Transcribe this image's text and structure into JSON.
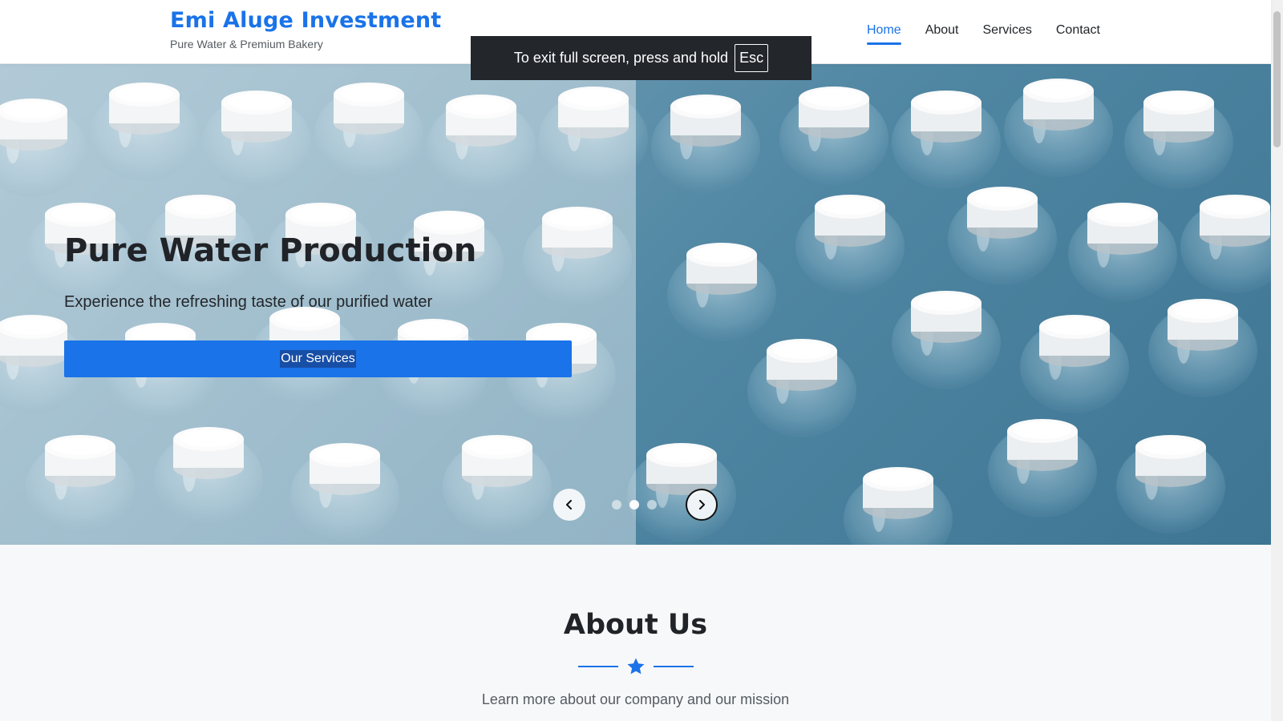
{
  "header": {
    "brand_title": "Emi Aluge Investment",
    "brand_subtitle": "Pure Water & Premium Bakery",
    "nav": [
      {
        "label": "Home",
        "active": true
      },
      {
        "label": "About",
        "active": false
      },
      {
        "label": "Services",
        "active": false
      },
      {
        "label": "Contact",
        "active": false
      }
    ]
  },
  "fullscreen_notice": {
    "text": "To exit full screen, press and hold",
    "key": "Esc"
  },
  "hero": {
    "title": "Pure Water Production",
    "subtitle": "Experience the refreshing taste of our purified water",
    "button_label": "Our Services",
    "slide_count": 3,
    "active_slide": 2,
    "prev_icon": "chevron-left-icon",
    "next_icon": "chevron-right-icon"
  },
  "about": {
    "title": "About Us",
    "divider_icon": "star-icon",
    "subtitle": "Learn more about our company and our mission"
  },
  "colors": {
    "accent": "#1a73e8",
    "text_dark": "#202327",
    "text_muted": "#555b61",
    "section_bg": "#f7f8fa"
  }
}
